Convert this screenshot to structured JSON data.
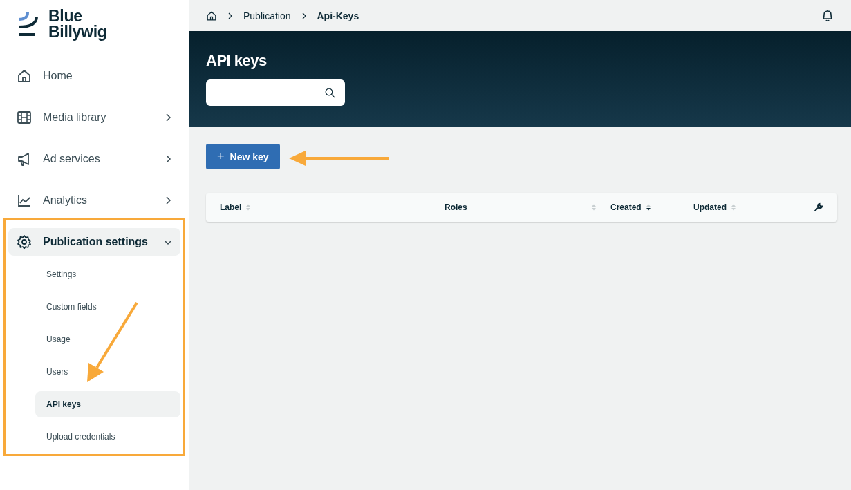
{
  "brand": {
    "line_1": "Blue",
    "line_2": "Billywig"
  },
  "nav": [
    {
      "kind": "link",
      "label": "Home",
      "selected": false
    },
    {
      "kind": "group",
      "label": "Media library",
      "expanded": false,
      "selected": false
    },
    {
      "kind": "group",
      "label": "Ad services",
      "expanded": false,
      "selected": false
    },
    {
      "kind": "group",
      "label": "Analytics",
      "expanded": false,
      "selected": false
    },
    {
      "kind": "group",
      "label": "Publication settings",
      "expanded": true,
      "selected": true,
      "children": [
        {
          "label": "Settings",
          "selected": false
        },
        {
          "label": "Custom fields",
          "selected": false
        },
        {
          "label": "Usage",
          "selected": false
        },
        {
          "label": "Users",
          "selected": false
        },
        {
          "label": "API keys",
          "selected": true
        },
        {
          "label": "Upload credentials",
          "selected": false
        }
      ]
    }
  ],
  "breadcrumb": [
    {
      "label": "Publication",
      "current": false
    },
    {
      "label": "Api-Keys",
      "current": true
    }
  ],
  "page_title": "API keys",
  "new_key_button": {
    "icon": "+",
    "label": "New key"
  },
  "table": {
    "columns": [
      {
        "label": "Label",
        "sorted": false
      },
      {
        "label": "Roles",
        "sorted": false
      },
      {
        "label": "Created",
        "sorted": true
      },
      {
        "label": "Updated",
        "sorted": false
      }
    ]
  }
}
